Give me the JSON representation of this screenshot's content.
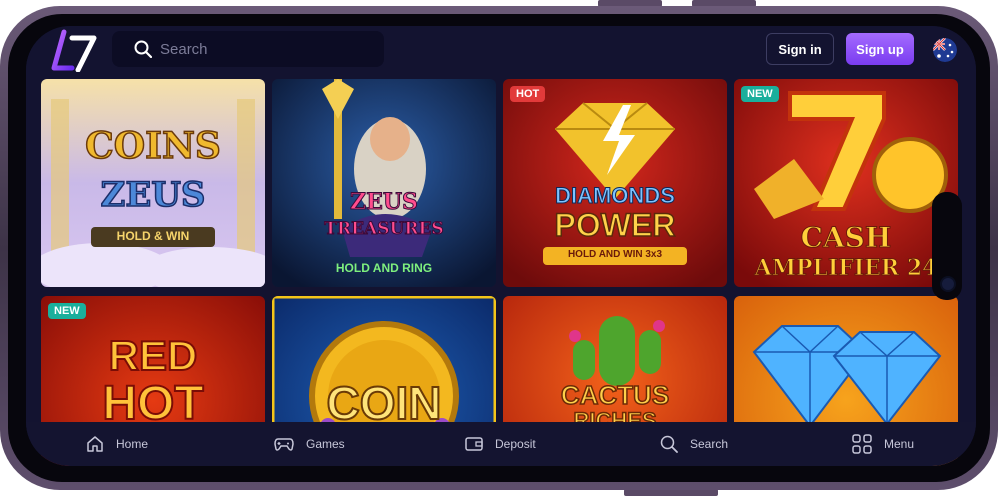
{
  "search": {
    "placeholder": "Search"
  },
  "auth": {
    "signin_label": "Sign in",
    "signup_label": "Sign up"
  },
  "language": {
    "flag_icon": "australia-flag-icon"
  },
  "colors": {
    "accent": "#8b4dff",
    "background": "#131330",
    "hot": "#e23a3a",
    "new": "#1aaf9c"
  },
  "games": [
    {
      "title": "Coins of Zeus",
      "line1": "COINS",
      "line2": "ZEUS",
      "line3": "HOLD & WIN",
      "badge": ""
    },
    {
      "title": "Zeus Treasures",
      "line1": "ZEUS",
      "line2": "TREASURES",
      "line3": "HOLD AND RING",
      "badge": ""
    },
    {
      "title": "Diamonds Power",
      "line1": "DIAMONDS",
      "line2": "POWER",
      "line3": "HOLD AND WIN 3x3",
      "badge": "HOT"
    },
    {
      "title": "Cash Amplifier 24",
      "line1": "CASH",
      "line2": "AMPLIFIER 24",
      "badge": "NEW"
    },
    {
      "title": "Red Hot",
      "line1": "RED",
      "line2": "HOT",
      "badge": "NEW"
    },
    {
      "title": "Coin",
      "line1": "COIN",
      "badge": ""
    },
    {
      "title": "Cactus Riches",
      "line1": "CACTUS",
      "line2": "RICHES",
      "badge": ""
    },
    {
      "title": "Diamonds",
      "badge": ""
    }
  ],
  "nav": [
    {
      "label": "Home",
      "icon": "home-icon"
    },
    {
      "label": "Games",
      "icon": "gamepad-icon"
    },
    {
      "label": "Deposit",
      "icon": "wallet-icon"
    },
    {
      "label": "Search",
      "icon": "search-icon"
    },
    {
      "label": "Menu",
      "icon": "grid-icon"
    }
  ]
}
